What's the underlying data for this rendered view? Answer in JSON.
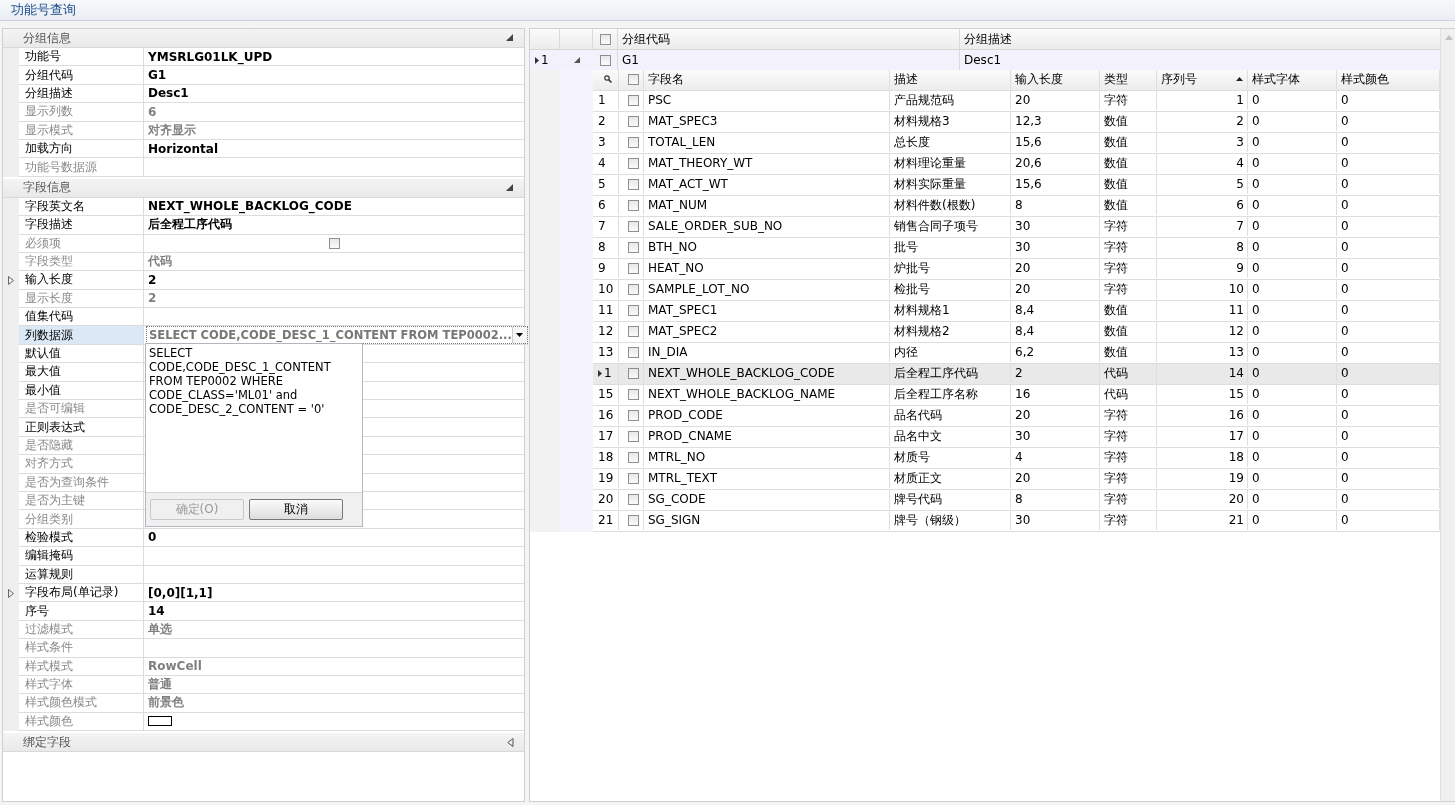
{
  "window": {
    "title": "功能号查询"
  },
  "property_grid": {
    "sections": [
      {
        "title": "分组信息",
        "expanded": true,
        "rows": [
          {
            "label": "功能号",
            "value": "YMSRLG01LK_UPD",
            "kind": "text",
            "disabled": false,
            "expandable": false,
            "selected": false
          },
          {
            "label": "分组代码",
            "value": "G1",
            "kind": "text",
            "disabled": false,
            "expandable": false,
            "selected": false
          },
          {
            "label": "分组描述",
            "value": "Desc1",
            "kind": "text",
            "disabled": false,
            "expandable": false,
            "selected": false
          },
          {
            "label": "显示列数",
            "value": "6",
            "kind": "text",
            "disabled": true,
            "expandable": false,
            "selected": false
          },
          {
            "label": "显示模式",
            "value": "对齐显示",
            "kind": "text",
            "disabled": true,
            "expandable": false,
            "selected": false
          },
          {
            "label": "加载方向",
            "value": "Horizontal",
            "kind": "text",
            "disabled": false,
            "expandable": false,
            "selected": false
          },
          {
            "label": "功能号数据源",
            "kind": "text",
            "disabled": true,
            "expandable": false,
            "selected": false
          }
        ]
      },
      {
        "title": "字段信息",
        "expanded": true,
        "rows": [
          {
            "label": "字段英文名",
            "value": "NEXT_WHOLE_BACKLOG_CODE",
            "kind": "text",
            "disabled": false,
            "expandable": false,
            "selected": false
          },
          {
            "label": "字段描述",
            "value": "后全程工序代码",
            "kind": "text",
            "disabled": false,
            "expandable": false,
            "selected": false
          },
          {
            "label": "必须项",
            "kind": "checkbox",
            "checked": false,
            "disabled": true,
            "expandable": false,
            "selected": false
          },
          {
            "label": "字段类型",
            "value": "代码",
            "kind": "text",
            "disabled": true,
            "expandable": false,
            "selected": false
          },
          {
            "label": "输入长度",
            "value": "2",
            "kind": "text",
            "disabled": false,
            "expandable": true,
            "selected": false
          },
          {
            "label": "显示长度",
            "value": "2",
            "kind": "text",
            "disabled": true,
            "expandable": false,
            "selected": false
          },
          {
            "label": "值集代码",
            "kind": "text",
            "disabled": false,
            "expandable": false,
            "selected": false
          },
          {
            "label": "列数据源",
            "value": "SELECT CODE,CODE_DESC_1_CONTENT  FROM TEP0002...",
            "kind": "dropdown",
            "disabled": false,
            "expandable": false,
            "selected": true,
            "popup": {
              "text": "SELECT\nCODE,CODE_DESC_1_CONTENT\nFROM TEP0002 WHERE\nCODE_CLASS='ML01' and\nCODE_DESC_2_CONTENT = '0'",
              "buttons": [
                {
                  "label": "确定(O)",
                  "disabled": true
                },
                {
                  "label": "取消",
                  "disabled": false
                }
              ]
            }
          },
          {
            "label": "默认值",
            "kind": "text",
            "disabled": false,
            "expandable": false,
            "selected": false
          },
          {
            "label": "最大值",
            "kind": "text",
            "disabled": false,
            "expandable": false,
            "selected": false
          },
          {
            "label": "最小值",
            "kind": "text",
            "disabled": false,
            "expandable": false,
            "selected": false
          },
          {
            "label": "是否可编辑",
            "kind": "text",
            "disabled": true,
            "expandable": false,
            "selected": false
          },
          {
            "label": "正则表达式",
            "kind": "text",
            "disabled": false,
            "expandable": false,
            "selected": false
          },
          {
            "label": "是否隐藏",
            "kind": "text",
            "disabled": true,
            "expandable": false,
            "selected": false
          },
          {
            "label": "对齐方式",
            "kind": "text",
            "disabled": true,
            "expandable": false,
            "selected": false
          },
          {
            "label": "是否为查询条件",
            "kind": "text",
            "disabled": true,
            "expandable": false,
            "selected": false
          },
          {
            "label": "是否为主键",
            "kind": "text",
            "disabled": true,
            "expandable": false,
            "selected": false
          },
          {
            "label": "分组类别",
            "kind": "text",
            "disabled": true,
            "expandable": false,
            "selected": false
          },
          {
            "label": "检验模式",
            "value": "0",
            "kind": "text",
            "disabled": false,
            "expandable": false,
            "selected": false
          },
          {
            "label": "编辑掩码",
            "kind": "text",
            "disabled": false,
            "expandable": false,
            "selected": false
          },
          {
            "label": "运算规则",
            "kind": "text",
            "disabled": false,
            "expandable": false,
            "selected": false
          },
          {
            "label": "字段布局(单记录)",
            "value": "[0,0][1,1]",
            "kind": "text",
            "disabled": false,
            "expandable": true,
            "selected": false
          },
          {
            "label": "序号",
            "value": "14",
            "kind": "text",
            "disabled": false,
            "expandable": false,
            "selected": false
          },
          {
            "label": "过滤模式",
            "value": "单选",
            "kind": "text",
            "disabled": true,
            "expandable": false,
            "selected": false
          },
          {
            "label": "样式条件",
            "kind": "text",
            "disabled": true,
            "expandable": false,
            "selected": false
          },
          {
            "label": "样式模式",
            "value": "RowCell",
            "kind": "text",
            "disabled": true,
            "expandable": false,
            "selected": false
          },
          {
            "label": "样式字体",
            "value": "普通",
            "kind": "text",
            "disabled": true,
            "expandable": false,
            "selected": false
          },
          {
            "label": "样式颜色模式",
            "value": "前景色",
            "kind": "text",
            "disabled": true,
            "expandable": false,
            "selected": false
          },
          {
            "label": "样式颜色",
            "kind": "color_swatch",
            "disabled": true,
            "expandable": false,
            "selected": false
          }
        ]
      },
      {
        "title": "绑定字段",
        "expanded": false
      }
    ]
  },
  "master_grid": {
    "header_checked": false,
    "columns": [
      "分组代码",
      "分组描述"
    ],
    "rows": [
      {
        "indicator": "1",
        "focused": true,
        "expanded": true,
        "checked": false,
        "cells": [
          "G1",
          "Desc1"
        ],
        "detail": {
          "header_checked": false,
          "columns": [
            {
              "label": "字段名",
              "sorted": false
            },
            {
              "label": "描述",
              "sorted": false
            },
            {
              "label": "输入长度",
              "sorted": false
            },
            {
              "label": "类型",
              "sorted": false
            },
            {
              "label": "序列号",
              "sorted": true
            },
            {
              "label": "样式字体",
              "sorted": false
            },
            {
              "label": "样式颜色",
              "sorted": false
            }
          ],
          "rows": [
            {
              "indicator": "1",
              "focused": false,
              "checked": false,
              "cells": [
                "PSC",
                "产品规范码",
                "20",
                "字符",
                "1",
                "0",
                "0"
              ]
            },
            {
              "indicator": "2",
              "focused": false,
              "checked": false,
              "cells": [
                "MAT_SPEC3",
                "材料规格3",
                "12,3",
                "数值",
                "2",
                "0",
                "0"
              ]
            },
            {
              "indicator": "3",
              "focused": false,
              "checked": false,
              "cells": [
                "TOTAL_LEN",
                "总长度",
                "15,6",
                "数值",
                "3",
                "0",
                "0"
              ]
            },
            {
              "indicator": "4",
              "focused": false,
              "checked": false,
              "cells": [
                "MAT_THEORY_WT",
                "材料理论重量",
                "20,6",
                "数值",
                "4",
                "0",
                "0"
              ]
            },
            {
              "indicator": "5",
              "focused": false,
              "checked": false,
              "cells": [
                "MAT_ACT_WT",
                "材料实际重量",
                "15,6",
                "数值",
                "5",
                "0",
                "0"
              ]
            },
            {
              "indicator": "6",
              "focused": false,
              "checked": false,
              "cells": [
                "MAT_NUM",
                "材料件数(根数)",
                "8",
                "数值",
                "6",
                "0",
                "0"
              ]
            },
            {
              "indicator": "7",
              "focused": false,
              "checked": false,
              "cells": [
                "SALE_ORDER_SUB_NO",
                "销售合同子项号",
                "30",
                "字符",
                "7",
                "0",
                "0"
              ]
            },
            {
              "indicator": "8",
              "focused": false,
              "checked": false,
              "cells": [
                "BTH_NO",
                "批号",
                "30",
                "字符",
                "8",
                "0",
                "0"
              ]
            },
            {
              "indicator": "9",
              "focused": false,
              "checked": false,
              "cells": [
                "HEAT_NO",
                "炉批号",
                "20",
                "字符",
                "9",
                "0",
                "0"
              ]
            },
            {
              "indicator": "10",
              "focused": false,
              "checked": false,
              "cells": [
                "SAMPLE_LOT_NO",
                "检批号",
                "20",
                "字符",
                "10",
                "0",
                "0"
              ]
            },
            {
              "indicator": "11",
              "focused": false,
              "checked": false,
              "cells": [
                "MAT_SPEC1",
                "材料规格1",
                "8,4",
                "数值",
                "11",
                "0",
                "0"
              ]
            },
            {
              "indicator": "12",
              "focused": false,
              "checked": false,
              "cells": [
                "MAT_SPEC2",
                "材料规格2",
                "8,4",
                "数值",
                "12",
                "0",
                "0"
              ]
            },
            {
              "indicator": "13",
              "focused": false,
              "checked": false,
              "cells": [
                "IN_DIA",
                "内径",
                "6,2",
                "数值",
                "13",
                "0",
                "0"
              ]
            },
            {
              "indicator": "1",
              "focused": true,
              "checked": false,
              "cells": [
                "NEXT_WHOLE_BACKLOG_CODE",
                "后全程工序代码",
                "2",
                "代码",
                "14",
                "0",
                "0"
              ]
            },
            {
              "indicator": "15",
              "focused": false,
              "checked": false,
              "cells": [
                "NEXT_WHOLE_BACKLOG_NAME",
                "后全程工序名称",
                "16",
                "代码",
                "15",
                "0",
                "0"
              ]
            },
            {
              "indicator": "16",
              "focused": false,
              "checked": false,
              "cells": [
                "PROD_CODE",
                "品名代码",
                "20",
                "字符",
                "16",
                "0",
                "0"
              ]
            },
            {
              "indicator": "17",
              "focused": false,
              "checked": false,
              "cells": [
                "PROD_CNAME",
                "品名中文",
                "30",
                "字符",
                "17",
                "0",
                "0"
              ]
            },
            {
              "indicator": "18",
              "focused": false,
              "checked": false,
              "cells": [
                "MTRL_NO",
                "材质号",
                "4",
                "字符",
                "18",
                "0",
                "0"
              ]
            },
            {
              "indicator": "19",
              "focused": false,
              "checked": false,
              "cells": [
                "MTRL_TEXT",
                "材质正文",
                "20",
                "字符",
                "19",
                "0",
                "0"
              ]
            },
            {
              "indicator": "20",
              "focused": false,
              "checked": false,
              "cells": [
                "SG_CODE",
                "牌号代码",
                "8",
                "字符",
                "20",
                "0",
                "0"
              ]
            },
            {
              "indicator": "21",
              "focused": false,
              "checked": false,
              "cells": [
                "SG_SIGN",
                "牌号（钢级）",
                "30",
                "字符",
                "21",
                "0",
                "0"
              ]
            }
          ]
        }
      }
    ]
  }
}
